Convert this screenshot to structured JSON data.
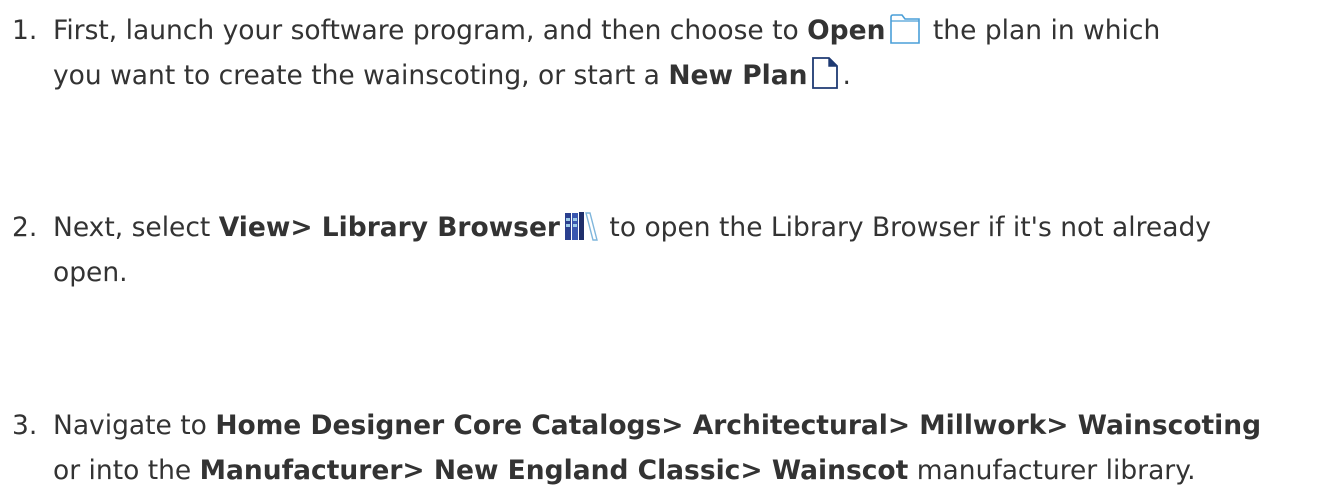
{
  "steps": [
    {
      "number": "1.",
      "part_a": "First, launch your software program, and then choose to ",
      "open_label": "Open",
      "open_icon": "open-folder-icon",
      "part_b": " the plan in which",
      "part_c": "you want to create the wainscoting, or start a ",
      "new_plan_label": "New Plan",
      "new_plan_icon": "new-plan-document-icon",
      "part_d": "."
    },
    {
      "number": "2.",
      "part_a": "Next, select ",
      "menu_label": "View> Library Browser",
      "library_icon": "library-browser-icon",
      "part_b": " to open the Library Browser if it's not already",
      "part_c": "open."
    },
    {
      "number": "3.",
      "part_a": "Navigate to ",
      "path_1": "Home Designer Core Catalogs> Architectural> Millwork> Wainscoting",
      "part_b": "or into the ",
      "path_2": "Manufacturer> New England Classic> Wainscot",
      "part_c": " manufacturer library."
    }
  ],
  "colors": {
    "text": "#333333",
    "folder_outline": "#4a9fd8",
    "document_outline": "#1f3a73",
    "library_blue": "#2a3f8f",
    "library_light": "#9ecbe8"
  }
}
